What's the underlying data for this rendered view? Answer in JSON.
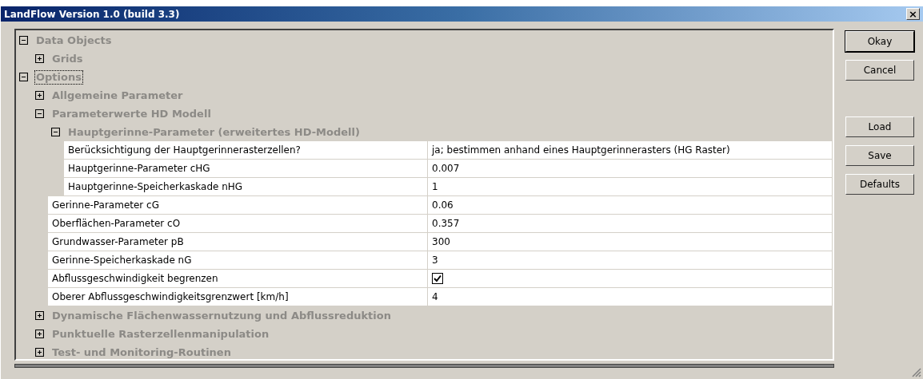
{
  "window": {
    "title": "LandFlow Version 1.0 (build 3.3)",
    "close": "×"
  },
  "tree": [
    {
      "kind": "group",
      "label": "Data Objects",
      "expanded": true,
      "focused": false,
      "children": [
        {
          "kind": "group",
          "label": "Grids",
          "expanded": false,
          "focused": false
        }
      ]
    },
    {
      "kind": "group",
      "label": "Options",
      "expanded": true,
      "focused": true,
      "children": [
        {
          "kind": "group",
          "label": "Allgemeine Parameter",
          "expanded": false,
          "focused": false
        },
        {
          "kind": "group",
          "label": "Parameterwerte HD Modell",
          "expanded": true,
          "focused": false,
          "children": [
            {
              "kind": "group",
              "label": "Hauptgerinne-Parameter (erweitertes HD-Modell)",
              "expanded": true,
              "focused": false,
              "children": [
                {
                  "kind": "property",
                  "name": "Berücksichtigung der Hauptgerinnerasterzellen?",
                  "value": "ja; bestimmen anhand eines Hauptgerinnerasters (HG Raster)"
                },
                {
                  "kind": "property",
                  "name": "Hauptgerinne-Parameter cHG",
                  "value": "0.007"
                },
                {
                  "kind": "property",
                  "name": "Hauptgerinne-Speicherkaskade nHG",
                  "value": "1"
                }
              ]
            },
            {
              "kind": "property",
              "name": "Gerinne-Parameter cG",
              "value": "0.06"
            },
            {
              "kind": "property",
              "name": "Oberflächen-Parameter cO",
              "value": "0.357"
            },
            {
              "kind": "property",
              "name": "Grundwasser-Parameter pB",
              "value": "300"
            },
            {
              "kind": "property",
              "name": "Gerinne-Speicherkaskade nG",
              "value": "3"
            },
            {
              "kind": "checkbox",
              "name": "Abflussgeschwindigkeit begrenzen",
              "checked": true
            },
            {
              "kind": "property",
              "name": "Oberer Abflussgeschwindigkeitsgrenzwert [km/h]",
              "value": "4"
            }
          ]
        },
        {
          "kind": "group",
          "label": "Dynamische Flächenwassernutzung und Abflussreduktion",
          "expanded": false,
          "focused": false
        },
        {
          "kind": "group",
          "label": "Punktuelle Rasterzellenmanipulation",
          "expanded": false,
          "focused": false
        },
        {
          "kind": "group",
          "label": "Test- und Monitoring-Routinen",
          "expanded": false,
          "focused": false
        }
      ]
    }
  ],
  "buttons": [
    {
      "label": "Okay",
      "default": true
    },
    {
      "label": "Cancel",
      "default": false
    },
    {
      "label": "Load",
      "default": false
    },
    {
      "label": "Save",
      "default": false
    },
    {
      "label": "Defaults",
      "default": false
    }
  ]
}
